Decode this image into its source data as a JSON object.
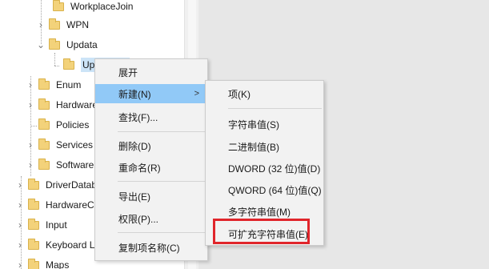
{
  "tree": {
    "items": [
      {
        "label": "WorkplaceJoin"
      },
      {
        "label": "WPN"
      },
      {
        "label": "Updata"
      },
      {
        "label": "Updata"
      },
      {
        "label": "Enum"
      },
      {
        "label": "Hardware"
      },
      {
        "label": "Policies"
      },
      {
        "label": "Services"
      },
      {
        "label": "Software"
      },
      {
        "label": "DriverDatabase"
      },
      {
        "label": "HardwareConfig"
      },
      {
        "label": "Input"
      },
      {
        "label": "Keyboard Layout"
      },
      {
        "label": "Maps"
      }
    ]
  },
  "context_menu": {
    "items": [
      {
        "label": "展开"
      },
      {
        "label": "新建(N)",
        "arrow": ">"
      },
      {
        "label": "查找(F)..."
      },
      {
        "label": "删除(D)"
      },
      {
        "label": "重命名(R)"
      },
      {
        "label": "导出(E)"
      },
      {
        "label": "权限(P)..."
      },
      {
        "label": "复制项名称(C)"
      }
    ]
  },
  "new_submenu": {
    "items": [
      {
        "label": "项(K)"
      },
      {
        "label": "字符串值(S)"
      },
      {
        "label": "二进制值(B)"
      },
      {
        "label": "DWORD (32 位)值(D)"
      },
      {
        "label": "QWORD (64 位)值(Q)"
      },
      {
        "label": "多字符串值(M)"
      },
      {
        "label": "可扩充字符串值(E)"
      }
    ]
  },
  "colors": {
    "hover": "#91c9f7",
    "selected": "#cce4f7",
    "highlight_border": "#e0252b",
    "folder": "#f3d27a"
  }
}
